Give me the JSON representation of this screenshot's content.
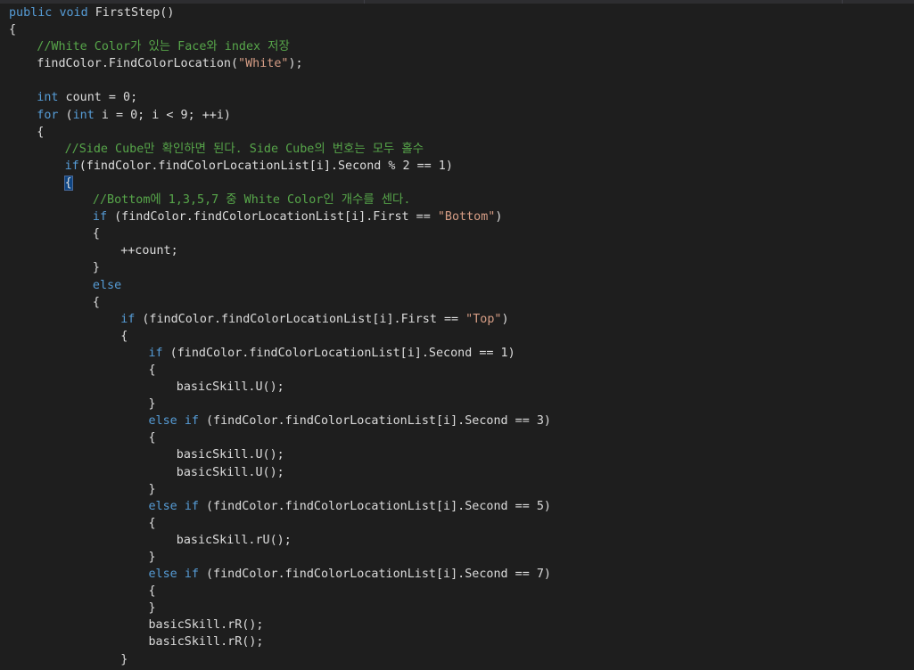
{
  "editor": {
    "lines": [
      {
        "indent": 0,
        "tokens": [
          {
            "t": "kw",
            "v": "public"
          },
          {
            "t": "pl",
            "v": " "
          },
          {
            "t": "kw",
            "v": "void"
          },
          {
            "t": "pl",
            "v": " FirstStep()"
          }
        ]
      },
      {
        "indent": 0,
        "tokens": [
          {
            "t": "pl",
            "v": "{"
          }
        ]
      },
      {
        "indent": 1,
        "tokens": [
          {
            "t": "cm",
            "v": "//White Color가 있는 Face와 index 저장"
          }
        ]
      },
      {
        "indent": 1,
        "tokens": [
          {
            "t": "pl",
            "v": "findColor.FindColorLocation("
          },
          {
            "t": "str",
            "v": "\"White\""
          },
          {
            "t": "pl",
            "v": ");"
          }
        ]
      },
      {
        "indent": 0,
        "tokens": []
      },
      {
        "indent": 1,
        "tokens": [
          {
            "t": "kw",
            "v": "int"
          },
          {
            "t": "pl",
            "v": " count = 0;"
          }
        ]
      },
      {
        "indent": 1,
        "tokens": [
          {
            "t": "kw",
            "v": "for"
          },
          {
            "t": "pl",
            "v": " ("
          },
          {
            "t": "kw",
            "v": "int"
          },
          {
            "t": "pl",
            "v": " i = 0; i < 9; ++i)"
          }
        ]
      },
      {
        "indent": 1,
        "tokens": [
          {
            "t": "pl",
            "v": "{"
          }
        ]
      },
      {
        "indent": 2,
        "tokens": [
          {
            "t": "cm",
            "v": "//Side Cube만 확인하면 된다. Side Cube의 번호는 모두 홀수"
          }
        ]
      },
      {
        "indent": 2,
        "tokens": [
          {
            "t": "kw",
            "v": "if"
          },
          {
            "t": "pl",
            "v": "(findColor.findColorLocationList[i].Second % 2 == 1)"
          }
        ]
      },
      {
        "indent": 2,
        "tokens": [
          {
            "t": "match",
            "v": "{"
          }
        ]
      },
      {
        "indent": 3,
        "tokens": [
          {
            "t": "cm",
            "v": "//Bottom에 1,3,5,7 중 White Color인 개수를 센다."
          }
        ]
      },
      {
        "indent": 3,
        "tokens": [
          {
            "t": "kw",
            "v": "if"
          },
          {
            "t": "pl",
            "v": " (findColor.findColorLocationList[i].First == "
          },
          {
            "t": "str",
            "v": "\"Bottom\""
          },
          {
            "t": "pl",
            "v": ")"
          }
        ]
      },
      {
        "indent": 3,
        "tokens": [
          {
            "t": "pl",
            "v": "{"
          }
        ]
      },
      {
        "indent": 4,
        "tokens": [
          {
            "t": "pl",
            "v": "++count;"
          }
        ]
      },
      {
        "indent": 3,
        "tokens": [
          {
            "t": "pl",
            "v": "}"
          }
        ]
      },
      {
        "indent": 3,
        "tokens": [
          {
            "t": "kw",
            "v": "else"
          }
        ]
      },
      {
        "indent": 3,
        "tokens": [
          {
            "t": "pl",
            "v": "{"
          }
        ]
      },
      {
        "indent": 4,
        "tokens": [
          {
            "t": "kw",
            "v": "if"
          },
          {
            "t": "pl",
            "v": " (findColor.findColorLocationList[i].First == "
          },
          {
            "t": "str",
            "v": "\"Top\""
          },
          {
            "t": "pl",
            "v": ")"
          }
        ]
      },
      {
        "indent": 4,
        "tokens": [
          {
            "t": "pl",
            "v": "{"
          }
        ]
      },
      {
        "indent": 5,
        "tokens": [
          {
            "t": "kw",
            "v": "if"
          },
          {
            "t": "pl",
            "v": " (findColor.findColorLocationList[i].Second == 1)"
          }
        ]
      },
      {
        "indent": 5,
        "tokens": [
          {
            "t": "pl",
            "v": "{"
          }
        ]
      },
      {
        "indent": 6,
        "tokens": [
          {
            "t": "pl",
            "v": "basicSkill.U();"
          }
        ]
      },
      {
        "indent": 5,
        "tokens": [
          {
            "t": "pl",
            "v": "}"
          }
        ]
      },
      {
        "indent": 5,
        "tokens": [
          {
            "t": "kw",
            "v": "else"
          },
          {
            "t": "pl",
            "v": " "
          },
          {
            "t": "kw",
            "v": "if"
          },
          {
            "t": "pl",
            "v": " (findColor.findColorLocationList[i].Second == 3)"
          }
        ]
      },
      {
        "indent": 5,
        "tokens": [
          {
            "t": "pl",
            "v": "{"
          }
        ]
      },
      {
        "indent": 6,
        "tokens": [
          {
            "t": "pl",
            "v": "basicSkill.U();"
          }
        ]
      },
      {
        "indent": 6,
        "tokens": [
          {
            "t": "pl",
            "v": "basicSkill.U();"
          }
        ]
      },
      {
        "indent": 5,
        "tokens": [
          {
            "t": "pl",
            "v": "}"
          }
        ]
      },
      {
        "indent": 5,
        "tokens": [
          {
            "t": "kw",
            "v": "else"
          },
          {
            "t": "pl",
            "v": " "
          },
          {
            "t": "kw",
            "v": "if"
          },
          {
            "t": "pl",
            "v": " (findColor.findColorLocationList[i].Second == 5)"
          }
        ]
      },
      {
        "indent": 5,
        "tokens": [
          {
            "t": "pl",
            "v": "{"
          }
        ]
      },
      {
        "indent": 6,
        "tokens": [
          {
            "t": "pl",
            "v": "basicSkill.rU();"
          }
        ]
      },
      {
        "indent": 5,
        "tokens": [
          {
            "t": "pl",
            "v": "}"
          }
        ]
      },
      {
        "indent": 5,
        "tokens": [
          {
            "t": "kw",
            "v": "else"
          },
          {
            "t": "pl",
            "v": " "
          },
          {
            "t": "kw",
            "v": "if"
          },
          {
            "t": "pl",
            "v": " (findColor.findColorLocationList[i].Second == 7)"
          }
        ]
      },
      {
        "indent": 5,
        "tokens": [
          {
            "t": "pl",
            "v": "{"
          }
        ]
      },
      {
        "indent": 5,
        "tokens": [
          {
            "t": "pl",
            "v": "}"
          }
        ]
      },
      {
        "indent": 5,
        "tokens": [
          {
            "t": "pl",
            "v": "basicSkill.rR();"
          }
        ]
      },
      {
        "indent": 5,
        "tokens": [
          {
            "t": "pl",
            "v": "basicSkill.rR();"
          }
        ]
      },
      {
        "indent": 4,
        "tokens": [
          {
            "t": "pl",
            "v": "}"
          }
        ]
      }
    ]
  },
  "colors": {
    "background": "#1e1e1e",
    "keyword": "#569cd6",
    "comment": "#57a64a",
    "string": "#d69d85",
    "plain": "#dcdcdc"
  }
}
